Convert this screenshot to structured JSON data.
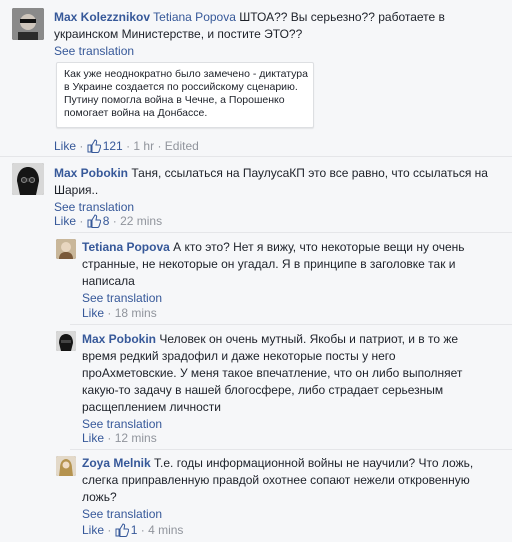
{
  "comments": [
    {
      "author": "Max Kolezznikov",
      "mention": "Tetiana Popova",
      "text": "ШТОА?? Вы серьезно?? работаете в украинском Министерстве, и постите ЭТО??",
      "see_translation": "See translation",
      "quote_text": "Как уже неоднократно было замечено - диктатура в Украине создается по российскому сценарию. Путину помогла война в Чечне, а Порошенко помогает война на Донбассе.",
      "like_label": "Like",
      "like_count": "121",
      "separator": "·",
      "time": "1 hr",
      "edited": "Edited"
    },
    {
      "author": "Max Pobokin",
      "text": "Таня, ссылаться на ПаулусаКП это все равно, что ссылаться на Шария..",
      "see_translation": "See translation",
      "like_label": "Like",
      "like_count": "8",
      "separator": "·",
      "time": "22 mins"
    }
  ],
  "replies": [
    {
      "author": "Tetiana Popova",
      "text": "А кто это? Нет я вижу, что некоторые вещи ну очень странные, не некоторые он угадал. Я в принципе в заголовке так и написала",
      "see_translation": "See translation",
      "like_label": "Like",
      "separator": "·",
      "time": "18 mins"
    },
    {
      "author": "Max Pobokin",
      "text": "Человек он очень мутный. Якобы и патриот, и в то же время редкий зрадофил и даже некоторые посты у него проАхметовские. У меня такое впечатление, что он либо выполняет какую-то задачу в нашей блогосфере, либо страдает серьезным расщеплением личности",
      "see_translation": "See translation",
      "like_label": "Like",
      "separator": "·",
      "time": "12 mins"
    },
    {
      "author": "Zoya Melnik",
      "text": "Т.е. годы информационной войны не научили? Что ложь, слегка приправленную правдой охотнее сопают нежели откровенную ложь?",
      "see_translation": "See translation",
      "like_label": "Like",
      "like_count": "1",
      "separator": "·",
      "time": "4 mins"
    }
  ],
  "colors": {
    "link": "#365899",
    "meta": "#90949c",
    "text": "#1d2129",
    "background": "#f6f7f9"
  },
  "icons": [
    "thumbs-up-icon"
  ]
}
